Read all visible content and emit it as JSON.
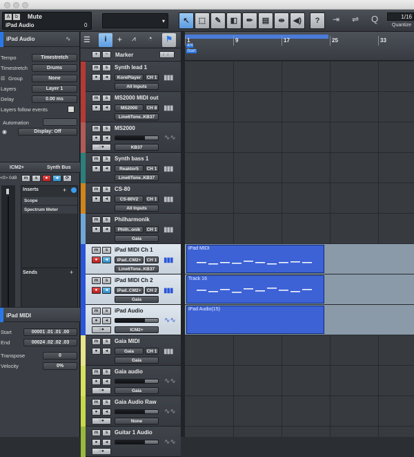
{
  "toolbar": {
    "track_name": "Mute",
    "track_sub": "iPad Audio",
    "track_value": "0",
    "quantize_value": "1/16",
    "quantize_label": "Quantize",
    "help_label": "?",
    "midi_badge": "A",
    "monitor_badge": "b"
  },
  "inspector": {
    "title": "iPad Audio",
    "rows": [
      {
        "label": "Tempo",
        "value": "Timestretch"
      },
      {
        "label": "Timestretch",
        "value": "Drums"
      },
      {
        "label": "Group",
        "value": "None"
      },
      {
        "label": "Layers",
        "value": "Layer 1"
      },
      {
        "label": "Delay",
        "value": "0.00 ms"
      }
    ],
    "layers_follow": "Layers follow events",
    "automation": "Automation",
    "display_label": "Display: Off",
    "channel_a": "ICM2+",
    "channel_b": "Synth Bus",
    "gain": "<0>",
    "gain_db": "0dB",
    "inserts": "Inserts",
    "insert_items": [
      "Scope",
      "Spectrum Meter"
    ],
    "sends": "Sends",
    "midi_title": "iPad MIDI",
    "start_label": "Start",
    "start_value": "00001 .01 .01 .00",
    "end_label": "End",
    "end_value": "00024 .02 .02 .03",
    "transpose_label": "Transpose",
    "transpose_value": "0",
    "velocity_label": "Velocity",
    "velocity_value": "0%"
  },
  "trackcolumn": {
    "marker_label": "Marker",
    "plus": "+",
    "minus": "−"
  },
  "tracks": [
    {
      "name": "Synth lead 1",
      "f1": "KorePlayer",
      "f2": "CH 1",
      "f3": "All Inputs",
      "color": "#b53a34",
      "type": "midi"
    },
    {
      "name": "MS2000 MIDI out",
      "f1": "MS2000",
      "f2": "CH 8",
      "f3": "Line6Tone..KB37",
      "color": "#b53a34",
      "type": "midi"
    },
    {
      "name": "MS2000",
      "f1": "",
      "f2": "",
      "f3": "KB37",
      "color": "#b35a57",
      "type": "audio"
    },
    {
      "name": "Synth bass 1",
      "f1": "Reaktor5",
      "f2": "CH 1",
      "f3": "Line6Tone..KB37",
      "color": "#2c7f7c",
      "type": "midi"
    },
    {
      "name": "CS-80",
      "f1": "CS-80V2",
      "f2": "CH 1",
      "f3": "All Inputs",
      "color": "#d0841c",
      "type": "midi"
    },
    {
      "name": "Philharmonik",
      "f1": "Philh..onik",
      "f2": "CH 1",
      "f3": "Gaia",
      "color": "#6fa7da",
      "type": "midi"
    },
    {
      "name": "iPad MIDI Ch 1",
      "f1": "iPad..CM2+",
      "f2": "CH 1",
      "f3": "Line6Tone..KB37",
      "color": "#2a55d8",
      "type": "midi",
      "selected": true
    },
    {
      "name": "iPad MIDI Ch 2",
      "f1": "iPad..CM2+",
      "f2": "CH 2",
      "f3": "Gaia",
      "color": "#2a55d8",
      "type": "midi",
      "selected": true
    },
    {
      "name": "iPad Audio",
      "f1": "",
      "f2": "",
      "f3": "ICM2+",
      "color": "#2a55d8",
      "type": "audio",
      "selected": true
    },
    {
      "name": "Gaia MIDI",
      "f1": "Gaia",
      "f2": "CH 1",
      "f3": "Gaia",
      "color": "#e8e48a",
      "type": "midi"
    },
    {
      "name": "Gaia audio",
      "f1": "",
      "f2": "",
      "f3": "Gaia",
      "color": "#d8e060",
      "type": "audio"
    },
    {
      "name": "Gaia Audio Raw",
      "f1": "",
      "f2": "",
      "f3": "None",
      "color": "#c8d84a",
      "type": "audio"
    },
    {
      "name": "Guitar 1 Audio",
      "f1": "",
      "f2": "",
      "f3": "",
      "color": "#9ab83c",
      "type": "audio"
    }
  ],
  "ruler": {
    "bars": [
      "1",
      "9",
      "17",
      "25",
      "33"
    ],
    "time_sig": "4/4",
    "start_marker": "Start"
  },
  "events": [
    {
      "name": "iPad MIDI",
      "track": 6
    },
    {
      "name": "Track 16",
      "track": 7
    },
    {
      "name": "iPad Audio(15)",
      "track": 8
    }
  ],
  "colors": {
    "accent": "#2a78e8",
    "event_fill": "#3d62d6",
    "selected_track": "#dfe6ee"
  }
}
